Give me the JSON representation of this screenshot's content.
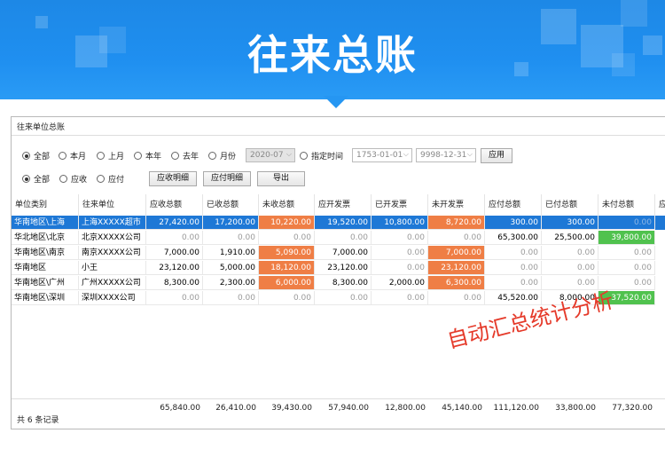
{
  "banner": {
    "title": "往来总账"
  },
  "window": {
    "title": "往来单位总账"
  },
  "filters": {
    "period": [
      {
        "label": "全部",
        "checked": true
      },
      {
        "label": "本月",
        "checked": false
      },
      {
        "label": "上月",
        "checked": false
      },
      {
        "label": "本年",
        "checked": false
      },
      {
        "label": "去年",
        "checked": false
      },
      {
        "label": "月份",
        "checked": false
      }
    ],
    "month_value": "2020-07",
    "custom_label": "指定时间",
    "date_from": "1753-01-01",
    "date_to": "9998-12-31",
    "apply_label": "应用",
    "type": [
      {
        "label": "全部",
        "checked": true
      },
      {
        "label": "应收",
        "checked": false
      },
      {
        "label": "应付",
        "checked": false
      }
    ],
    "btn_receivable_detail": "应收明细",
    "btn_payable_detail": "应付明细",
    "btn_export": "导出"
  },
  "table": {
    "columns": [
      "单位类别",
      "往来单位",
      "应收总额",
      "已收总额",
      "未收总额",
      "应开发票",
      "已开发票",
      "未开发票",
      "应付总额",
      "已付总额",
      "未付总额",
      "应"
    ],
    "rows": [
      [
        "华南地区\\上海",
        "上海XXXXX超市",
        "27,420.00",
        "17,200.00",
        "10,220.00",
        "19,520.00",
        "10,800.00",
        "8,720.00",
        "300.00",
        "300.00",
        "0.00"
      ],
      [
        "华北地区\\北京",
        "北京XXXXX公司",
        "0.00",
        "0.00",
        "0.00",
        "0.00",
        "0.00",
        "0.00",
        "65,300.00",
        "25,500.00",
        "39,800.00"
      ],
      [
        "华南地区\\南京",
        "南京XXXXX公司",
        "7,000.00",
        "1,910.00",
        "5,090.00",
        "7,000.00",
        "0.00",
        "7,000.00",
        "0.00",
        "0.00",
        "0.00"
      ],
      [
        "华南地区",
        "小王",
        "23,120.00",
        "5,000.00",
        "18,120.00",
        "23,120.00",
        "0.00",
        "23,120.00",
        "0.00",
        "0.00",
        "0.00"
      ],
      [
        "华南地区\\广州",
        "广州XXXXX公司",
        "8,300.00",
        "2,300.00",
        "6,000.00",
        "8,300.00",
        "2,000.00",
        "6,300.00",
        "0.00",
        "0.00",
        "0.00"
      ],
      [
        "华南地区\\深圳",
        "深圳XXXX公司",
        "0.00",
        "0.00",
        "0.00",
        "0.00",
        "0.00",
        "0.00",
        "45,520.00",
        "8,000.00",
        "37,520.00"
      ]
    ],
    "totals": [
      "65,840.00",
      "26,410.00",
      "39,430.00",
      "57,940.00",
      "12,800.00",
      "45,140.00",
      "111,120.00",
      "33,800.00",
      "77,320.00"
    ]
  },
  "footer": {
    "record_count": "共 6 条记录"
  },
  "annotation": "自动汇总统计分析",
  "colors": {
    "selected": "#1e78d6",
    "warning": "#ef7e45",
    "ok": "#50c24e",
    "banner": "#1f8ff0"
  }
}
